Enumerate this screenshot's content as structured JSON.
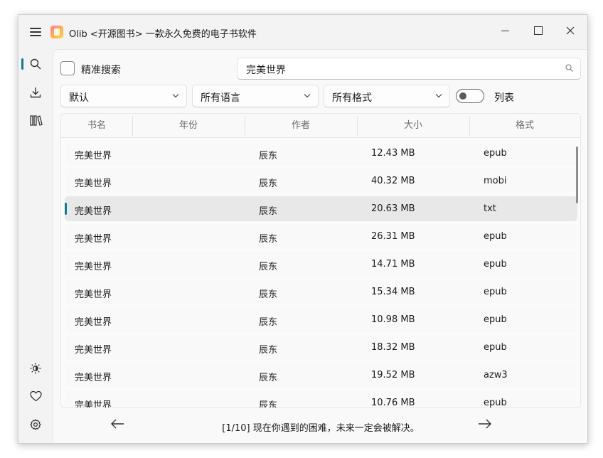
{
  "window": {
    "title": "Olib <开源图书> 一款永久免费的电子书软件"
  },
  "nav": {
    "items": [
      {
        "icon": "search-icon",
        "active": true
      },
      {
        "icon": "download-icon",
        "active": false
      },
      {
        "icon": "library-icon",
        "active": false
      }
    ],
    "bottom": [
      {
        "icon": "theme-icon"
      },
      {
        "icon": "heart-icon"
      },
      {
        "icon": "settings-icon"
      }
    ]
  },
  "search": {
    "exact_label": "精准搜索",
    "query": "完美世界"
  },
  "filters": {
    "sort": "默认",
    "language": "所有语言",
    "format": "所有格式",
    "list_label": "列表"
  },
  "table": {
    "columns": [
      "书名",
      "年份",
      "作者",
      "大小",
      "格式"
    ],
    "rows": [
      {
        "name": "完美世界",
        "year": "",
        "author": "辰东",
        "size": "12.43 MB",
        "format": "epub"
      },
      {
        "name": "完美世界",
        "year": "",
        "author": "辰东",
        "size": "40.32 MB",
        "format": "mobi"
      },
      {
        "name": "完美世界",
        "year": "",
        "author": "辰东",
        "size": "20.63 MB",
        "format": "txt"
      },
      {
        "name": "完美世界",
        "year": "",
        "author": "辰东",
        "size": "26.31 MB",
        "format": "epub"
      },
      {
        "name": "完美世界",
        "year": "",
        "author": "辰东",
        "size": "14.71 MB",
        "format": "epub"
      },
      {
        "name": "完美世界",
        "year": "",
        "author": "辰东",
        "size": "15.34 MB",
        "format": "epub"
      },
      {
        "name": "完美世界",
        "year": "",
        "author": "辰东",
        "size": "10.98 MB",
        "format": "epub"
      },
      {
        "name": "完美世界",
        "year": "",
        "author": "辰东",
        "size": "18.32 MB",
        "format": "epub"
      },
      {
        "name": "完美世界",
        "year": "",
        "author": "辰东",
        "size": "19.52 MB",
        "format": "azw3"
      },
      {
        "name": "完美世界",
        "year": "",
        "author": "辰东",
        "size": "10.76 MB",
        "format": "epub"
      }
    ],
    "selected_index": 2
  },
  "footer": {
    "status": "[1/10] 现在你遇到的困难，未来一定会被解决。"
  },
  "colors": {
    "accent": "#0a7f8f"
  }
}
